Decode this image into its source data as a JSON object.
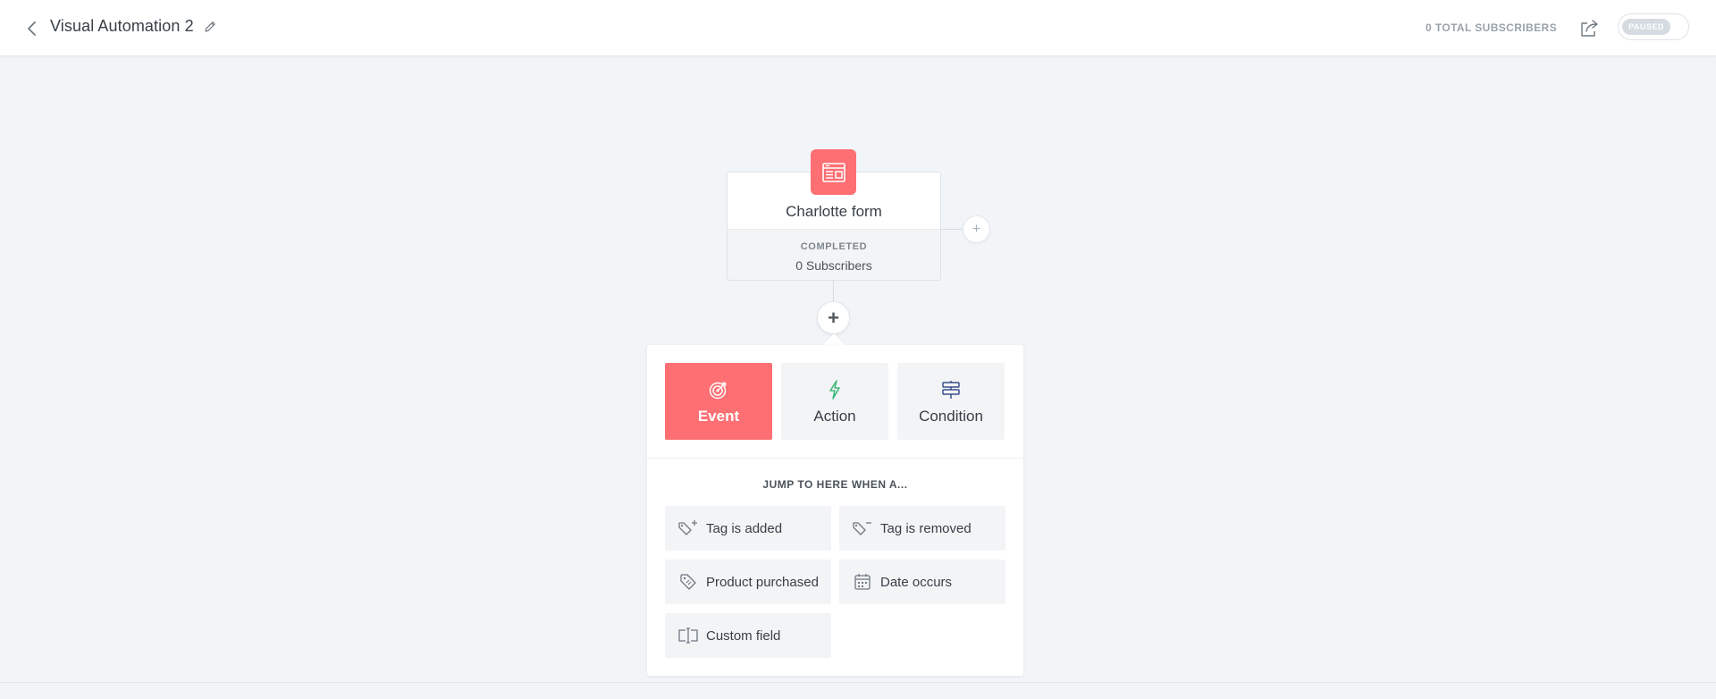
{
  "header": {
    "title": "Visual Automation 2",
    "total_subscribers": "0 TOTAL SUBSCRIBERS",
    "status_toggle": "PAUSED"
  },
  "form_node": {
    "title": "Charlotte form",
    "status": "COMPLETED",
    "subscribers": "0 Subscribers"
  },
  "add_buttons": {
    "side": "+",
    "main": "+"
  },
  "panel": {
    "tabs": [
      {
        "label": "Event",
        "icon": "target-icon",
        "active": true
      },
      {
        "label": "Action",
        "icon": "lightning-icon",
        "active": false
      },
      {
        "label": "Condition",
        "icon": "signpost-icon",
        "active": false
      }
    ],
    "jump_heading": "JUMP TO HERE WHEN A...",
    "options": [
      {
        "label": "Tag is added",
        "icon": "tag-plus-icon"
      },
      {
        "label": "Tag is removed",
        "icon": "tag-minus-icon"
      },
      {
        "label": "Product purchased",
        "icon": "product-tag-icon"
      },
      {
        "label": "Date occurs",
        "icon": "calendar-icon"
      },
      {
        "label": "Custom field",
        "icon": "custom-field-icon"
      }
    ]
  },
  "colors": {
    "accent": "#fd6f73",
    "action_icon": "#3cb878",
    "condition_icon": "#3a4e8c",
    "canvas": "#f2f5f8"
  }
}
